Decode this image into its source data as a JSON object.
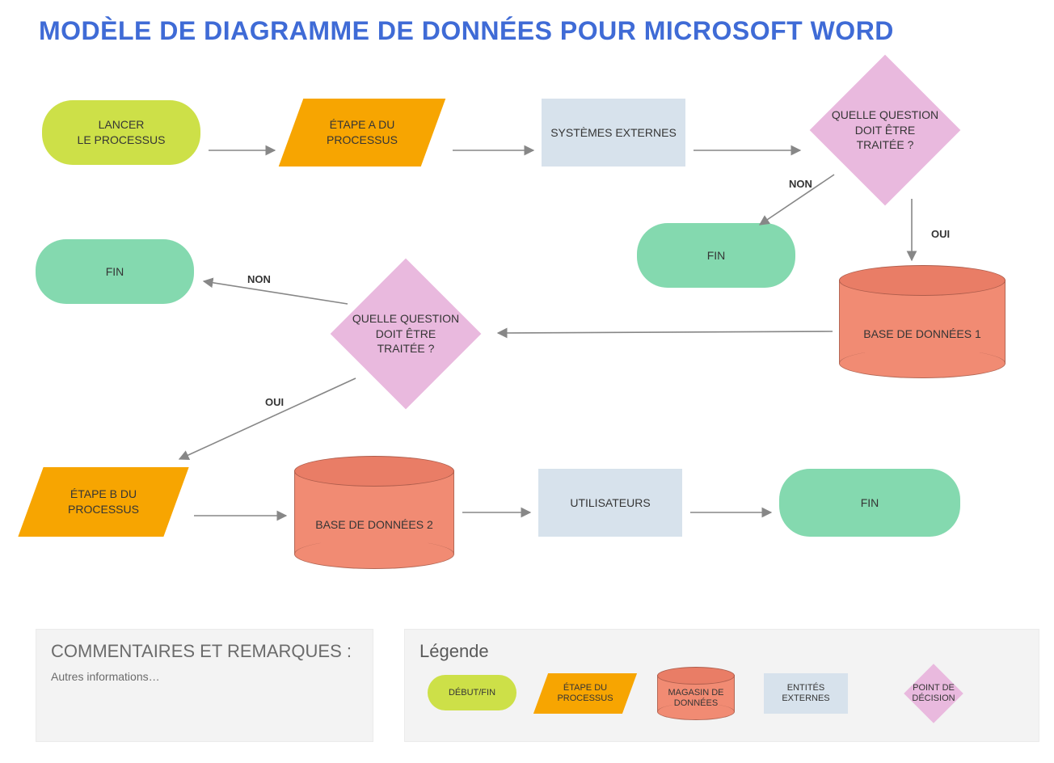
{
  "title": "MODÈLE DE DIAGRAMME DE DONNÉES POUR MICROSOFT WORD",
  "colors": {
    "terminator_start": "#cde048",
    "terminator_end": "#84d9af",
    "process": "#f7a501",
    "external": "#d7e2ec",
    "decision": "#e9b9de",
    "datastore_top": "#e97d66",
    "datastore_body": "#f18b73",
    "title": "#3f6bd6"
  },
  "nodes": {
    "start": {
      "label": "LANCER\nLE PROCESSUS"
    },
    "stepA": {
      "label": "ÉTAPE A DU\nPROCESSUS"
    },
    "ext1": {
      "label": "SYSTÈMES EXTERNES"
    },
    "dec1": {
      "label": "QUELLE QUESTION\nDOIT ÊTRE\nTRAITÉE ?"
    },
    "dec1_no": "NON",
    "dec1_yes": "OUI",
    "fin_no1": {
      "label": "FIN"
    },
    "db1": {
      "label": "BASE DE DONNÉES 1"
    },
    "dec2": {
      "label": "QUELLE QUESTION\nDOIT ÊTRE\nTRAITÉE ?"
    },
    "dec2_no": "NON",
    "dec2_yes": "OUI",
    "fin_no2": {
      "label": "FIN"
    },
    "stepB": {
      "label": "ÉTAPE B DU\nPROCESSUS"
    },
    "db2": {
      "label": "BASE DE DONNÉES 2"
    },
    "ext2": {
      "label": "UTILISATEURS"
    },
    "fin_final": {
      "label": "FIN"
    }
  },
  "comments": {
    "heading": "COMMENTAIRES ET REMARQUES :",
    "body": "Autres informations…"
  },
  "legend": {
    "heading": "Légende",
    "items": {
      "terminator": "DÉBUT/FIN",
      "process": "ÉTAPE DU\nPROCESSUS",
      "datastore": "MAGASIN DE\nDONNÉES",
      "external": "ENTITÉS\nEXTERNES",
      "decision": "POINT DE\nDÉCISION"
    }
  }
}
